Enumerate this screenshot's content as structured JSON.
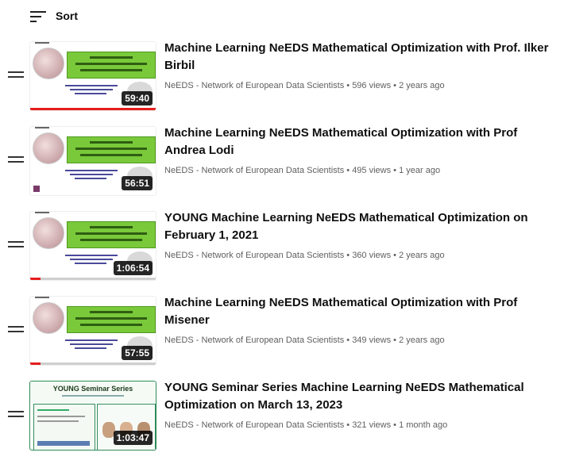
{
  "header": {
    "sort_label": "Sort",
    "sort_icon": "sort-icon"
  },
  "videos": [
    {
      "title": "Machine Learning NeEDS Mathematical Optimization with Prof. Ilker Birbil",
      "channel": "NeEDS - Network of European Data Scientists",
      "views": "596 views",
      "age": "2 years ago",
      "duration": "59:40",
      "watched_fraction": 1.0,
      "thumb_style": "seminar-series"
    },
    {
      "title": "Machine Learning NeEDS Mathematical Optimization with Prof Andrea Lodi",
      "channel": "NeEDS - Network of European Data Scientists",
      "views": "495 views",
      "age": "1 year ago",
      "duration": "56:51",
      "watched_fraction": 0.0,
      "thumb_style": "seminar-series"
    },
    {
      "title": "YOUNG Machine Learning NeEDS Mathematical Optimization on February 1, 2021",
      "channel": "NeEDS - Network of European Data Scientists",
      "views": "360 views",
      "age": "2 years ago",
      "duration": "1:06:54",
      "watched_fraction": 0.08,
      "thumb_style": "seminar-series"
    },
    {
      "title": "Machine Learning NeEDS Mathematical Optimization with Prof Misener",
      "channel": "NeEDS - Network of European Data Scientists",
      "views": "349 views",
      "age": "2 years ago",
      "duration": "57:55",
      "watched_fraction": 0.08,
      "thumb_style": "seminar-series"
    },
    {
      "title": "YOUNG Seminar Series Machine Learning NeEDS Mathematical Optimization on March 13, 2023",
      "channel": "NeEDS - Network of European Data Scientists",
      "views": "321 views",
      "age": "1 month ago",
      "duration": "1:03:47",
      "watched_fraction": 0.0,
      "thumb_style": "young-seminar-series",
      "thumb_text": "YOUNG Seminar Series"
    }
  ],
  "separator": " • ",
  "colors": {
    "progress": "#e61d1d",
    "meta_text": "#606060"
  }
}
